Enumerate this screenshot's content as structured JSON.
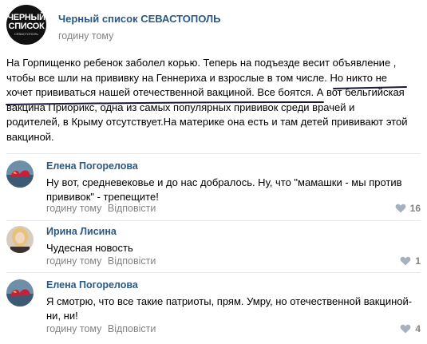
{
  "post": {
    "group_name": "Черный список СЕВАСТОПОЛЬ",
    "time": "годину тому",
    "avatar_text_line1": "ЧЕРНЫЙ",
    "avatar_text_line2": "СПИСОК",
    "avatar_text_line3": "СЕВАСТОПОЛЬ",
    "text_line1": "На Горпищенко ребенок заболел корью. Теперь на подъезде весит объявление ,",
    "text_line2": "чтобы все шли на прививку на Геннериха и взрослые в том числе. Но никто не",
    "text_line3": "хочет прививаться нашей отечественной вакциной. Все боятся. А вот бельгийская",
    "text_line4": "вакцина Приорикс, одна из самых популярных прививок среди врачей и",
    "text_line5": "родителей, в Крыму отсутствует.На материке она есть и там детей прививают этой",
    "text_line6": "вакциной."
  },
  "comments": [
    {
      "author": "Елена Погорелова",
      "text_line1": "Ну вот, средневековье и до нас добралось. Ну, что \"мамашки - мы против",
      "text_line2": "прививок\" - трепещите!",
      "time": "годину тому",
      "reply": "Відповісти",
      "likes": "16"
    },
    {
      "author": "Ирина Лисина",
      "text_line1": "Чудесная новость",
      "text_line2": "",
      "time": "годину тому",
      "reply": "Відповісти",
      "likes": "1"
    },
    {
      "author": "Елена Погорелова",
      "text_line1": "Я смотрю, что все такие патриоты, прям. Умру, но отечественной вакциной-",
      "text_line2": "ни, ни!",
      "time": "годину тому",
      "reply": "Відповісти",
      "likes": "4"
    }
  ],
  "colors": {
    "link": "#2a5885",
    "meta": "#828282",
    "underline": "#1a1a3a"
  }
}
